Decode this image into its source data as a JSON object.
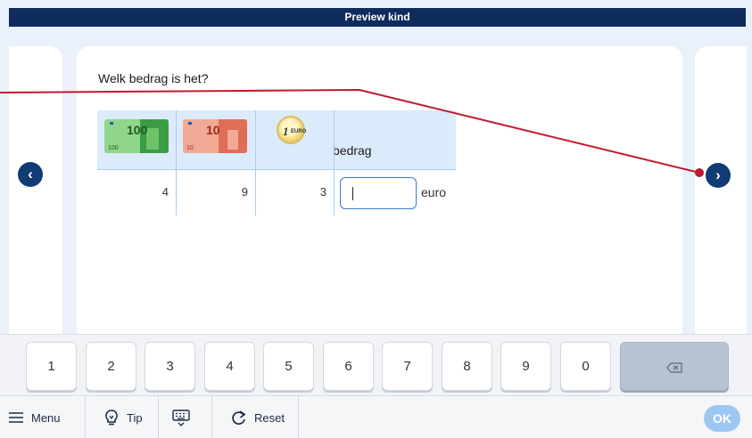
{
  "window": {
    "title": "Preview kind"
  },
  "question": {
    "text": "Welk bedrag is het?"
  },
  "table": {
    "columns": [
      {
        "icon": "banknote-100-icon",
        "label": "100",
        "count": "4"
      },
      {
        "icon": "banknote-10-icon",
        "label": "10",
        "count": "9"
      },
      {
        "icon": "coin-1-euro-icon",
        "label": "1",
        "sublabel": "EURO",
        "count": "3"
      }
    ],
    "answer_header": "bedrag",
    "answer_value": "",
    "answer_unit": "euro"
  },
  "keypad": {
    "keys": [
      "1",
      "2",
      "3",
      "4",
      "5",
      "6",
      "7",
      "8",
      "9",
      "0"
    ],
    "backspace_icon": "backspace-icon"
  },
  "toolbar": {
    "menu_label": "Menu",
    "tip_label": "Tip",
    "keyboard_icon": "keyboard-icon",
    "reset_label": "Reset",
    "ok_label": "OK"
  },
  "colors": {
    "title_bar": "#0f2c5c",
    "accent": "#113b74",
    "line": "#c0182e",
    "ok": "#9dc7f2",
    "table_header": "#dcebfb"
  }
}
